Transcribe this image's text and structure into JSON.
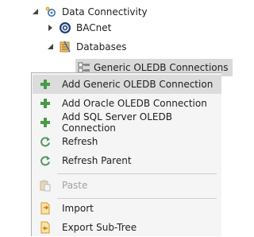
{
  "tree": {
    "data_connectivity": "Data Connectivity",
    "bacnet": "BACnet",
    "databases": "Databases",
    "generic_oledb": "Generic OLEDB Connections"
  },
  "menu": {
    "items": [
      {
        "label": "Add Generic OLEDB Connection",
        "icon": "plus-icon",
        "enabled": true
      },
      {
        "label": "Add Oracle OLEDB Connection",
        "icon": "plus-icon",
        "enabled": true
      },
      {
        "label": "Add SQL Server OLEDB Connection",
        "icon": "plus-icon",
        "enabled": true
      },
      {
        "label": "Refresh",
        "icon": "refresh-icon",
        "enabled": true
      },
      {
        "label": "Refresh Parent",
        "icon": "refresh-icon",
        "enabled": true
      },
      {
        "label": "Paste",
        "icon": "paste-icon",
        "enabled": false
      },
      {
        "label": "Import",
        "icon": "import-icon",
        "enabled": true
      },
      {
        "label": "Export Sub-Tree",
        "icon": "export-icon",
        "enabled": true
      }
    ]
  },
  "colors": {
    "plus": "#4a9a4a",
    "refresh": "#4f9a5a",
    "hover": "#dcdcdc",
    "menu_bg": "#f5f5f5"
  }
}
